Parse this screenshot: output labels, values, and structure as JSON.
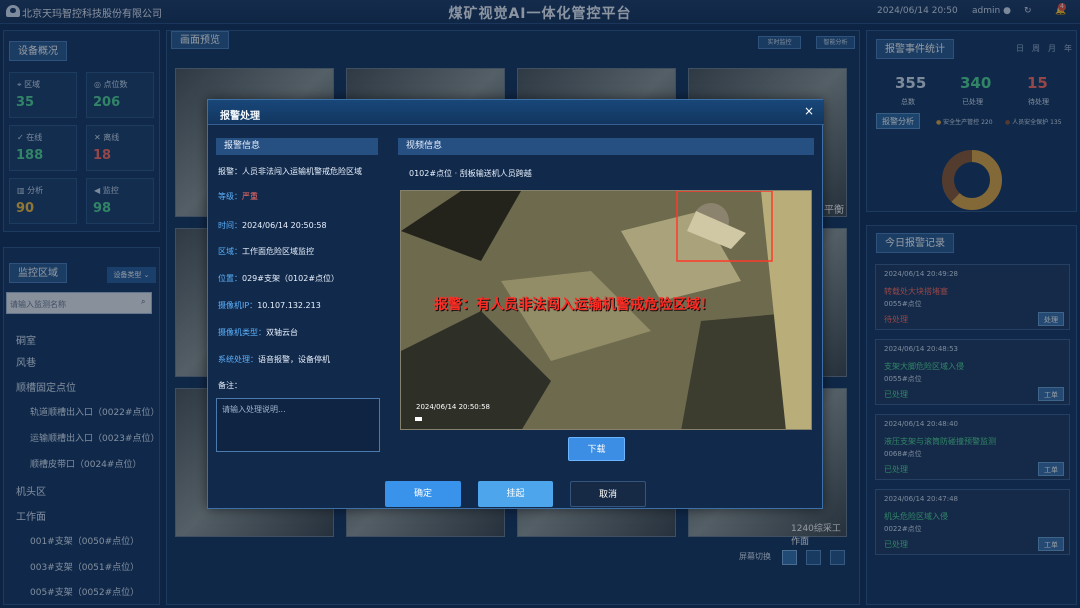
{
  "header": {
    "company": "北京天玛智控科技股份有限公司",
    "title": "煤矿视觉AI一体化管控平台",
    "datetime": "2024/06/14 20:50",
    "user": "admin",
    "notification_count": "4"
  },
  "device_overview": {
    "title": "设备概况",
    "stats": [
      {
        "label": "区域",
        "value": "35",
        "icon": "location-icon",
        "color": "#55d99a"
      },
      {
        "label": "点位数",
        "value": "206",
        "icon": "points-icon",
        "color": "#55d99a"
      },
      {
        "label": "在线",
        "value": "188",
        "icon": "online-icon",
        "color": "#55d99a"
      },
      {
        "label": "离线",
        "value": "18",
        "icon": "offline-icon",
        "color": "#ff6f66"
      },
      {
        "label": "分析",
        "value": "90",
        "icon": "analysis-icon",
        "color": "#f6c344"
      },
      {
        "label": "监控",
        "value": "98",
        "icon": "monitor-icon",
        "color": "#55d99a"
      }
    ]
  },
  "monitor_area": {
    "title": "监控区域",
    "device_type": "设备类型",
    "search_placeholder": "请输入监测名称",
    "items": [
      "硐室",
      "风巷",
      "顺槽固定点位",
      "轨道顺槽出入口（0022#点位）",
      "运输顺槽出入口（0023#点位）",
      "顺槽皮带口（0024#点位）",
      "机头区",
      "工作面",
      "001#支架（0050#点位）",
      "003#支架（0051#点位）",
      "005#支架（0052#点位）"
    ]
  },
  "preview": {
    "title": "画面预览",
    "realtime": "实时监控",
    "smart": "智能分析",
    "screen_switch": "屏幕切换",
    "video_label_1": "平衡",
    "video_label_2": "1240综采工作面"
  },
  "alarm_stats": {
    "title": "报警事件统计",
    "tabs": [
      "日",
      "周",
      "月",
      "年"
    ],
    "total_value": "355",
    "total_label": "总数",
    "processed_value": "340",
    "processed_label": "已处理",
    "pending_value": "15",
    "pending_label": "待处理",
    "analysis_label": "报警分析",
    "legend_safety": "安全生产管控 220",
    "legend_person": "人员安全保护 135",
    "donut_values": [
      220,
      135
    ],
    "colors": {
      "safety": "#e0a94a",
      "person": "#8e5d3a"
    }
  },
  "today_alarms": {
    "title": "今日报警记录",
    "cards": [
      {
        "time": "2024/06/14 20:49:28",
        "title": "转载处大块搭堵塞",
        "point": "0055#点位",
        "status": "待处理",
        "button": "处理",
        "title_color": "#ff6f66",
        "status_color": "#ff6f66"
      },
      {
        "time": "2024/06/14 20:48:53",
        "title": "支架大脚危险区域入侵",
        "point": "0055#点位",
        "status": "已处理",
        "button": "工单",
        "title_color": "#55d99a",
        "status_color": "#55d99a"
      },
      {
        "time": "2024/06/14 20:48:40",
        "title": "液压支架与滚筒防碰撞预警监测",
        "point": "0068#点位",
        "status": "已处理",
        "button": "工单",
        "title_color": "#55d99a",
        "status_color": "#55d99a"
      },
      {
        "time": "2024/06/14 20:47:48",
        "title": "机头危险区域入侵",
        "point": "0022#点位",
        "status": "已处理",
        "button": "工单",
        "title_color": "#55d99a",
        "status_color": "#55d99a"
      }
    ]
  },
  "modal": {
    "title": "报警处理",
    "alarm_info_title": "报警信息",
    "video_info_title": "视频信息",
    "alarm_label": "报警：",
    "alarm_value": "人员非法闯入运输机警戒危险区域",
    "level_label": "等级：",
    "level_value": "严重",
    "time_label": "时间：",
    "time_value": "2024/06/14 20:50:58",
    "area_label": "区域：",
    "area_value": "工作面危险区域监控",
    "position_label": "位置：",
    "position_value": "029#支架（0102#点位）",
    "ip_label": "摄像机IP：",
    "ip_value": "10.107.132.213",
    "camera_type_label": "摄像机类型：",
    "camera_type_value": "双轴云台",
    "system_label": "系统处理：",
    "system_value": "语音报警，设备停机",
    "remark_label": "备注：",
    "remark_placeholder": "请输入处理说明...",
    "video_caption": "0102#点位 · 刮板输送机人员跨越",
    "warning_text": "报警：有人员非法闯入运输机警戒危险区域！",
    "video_timestamp": "2024/06/14 20:50:58",
    "download": "下载",
    "confirm": "确定",
    "hold": "挂起",
    "cancel": "取消"
  }
}
